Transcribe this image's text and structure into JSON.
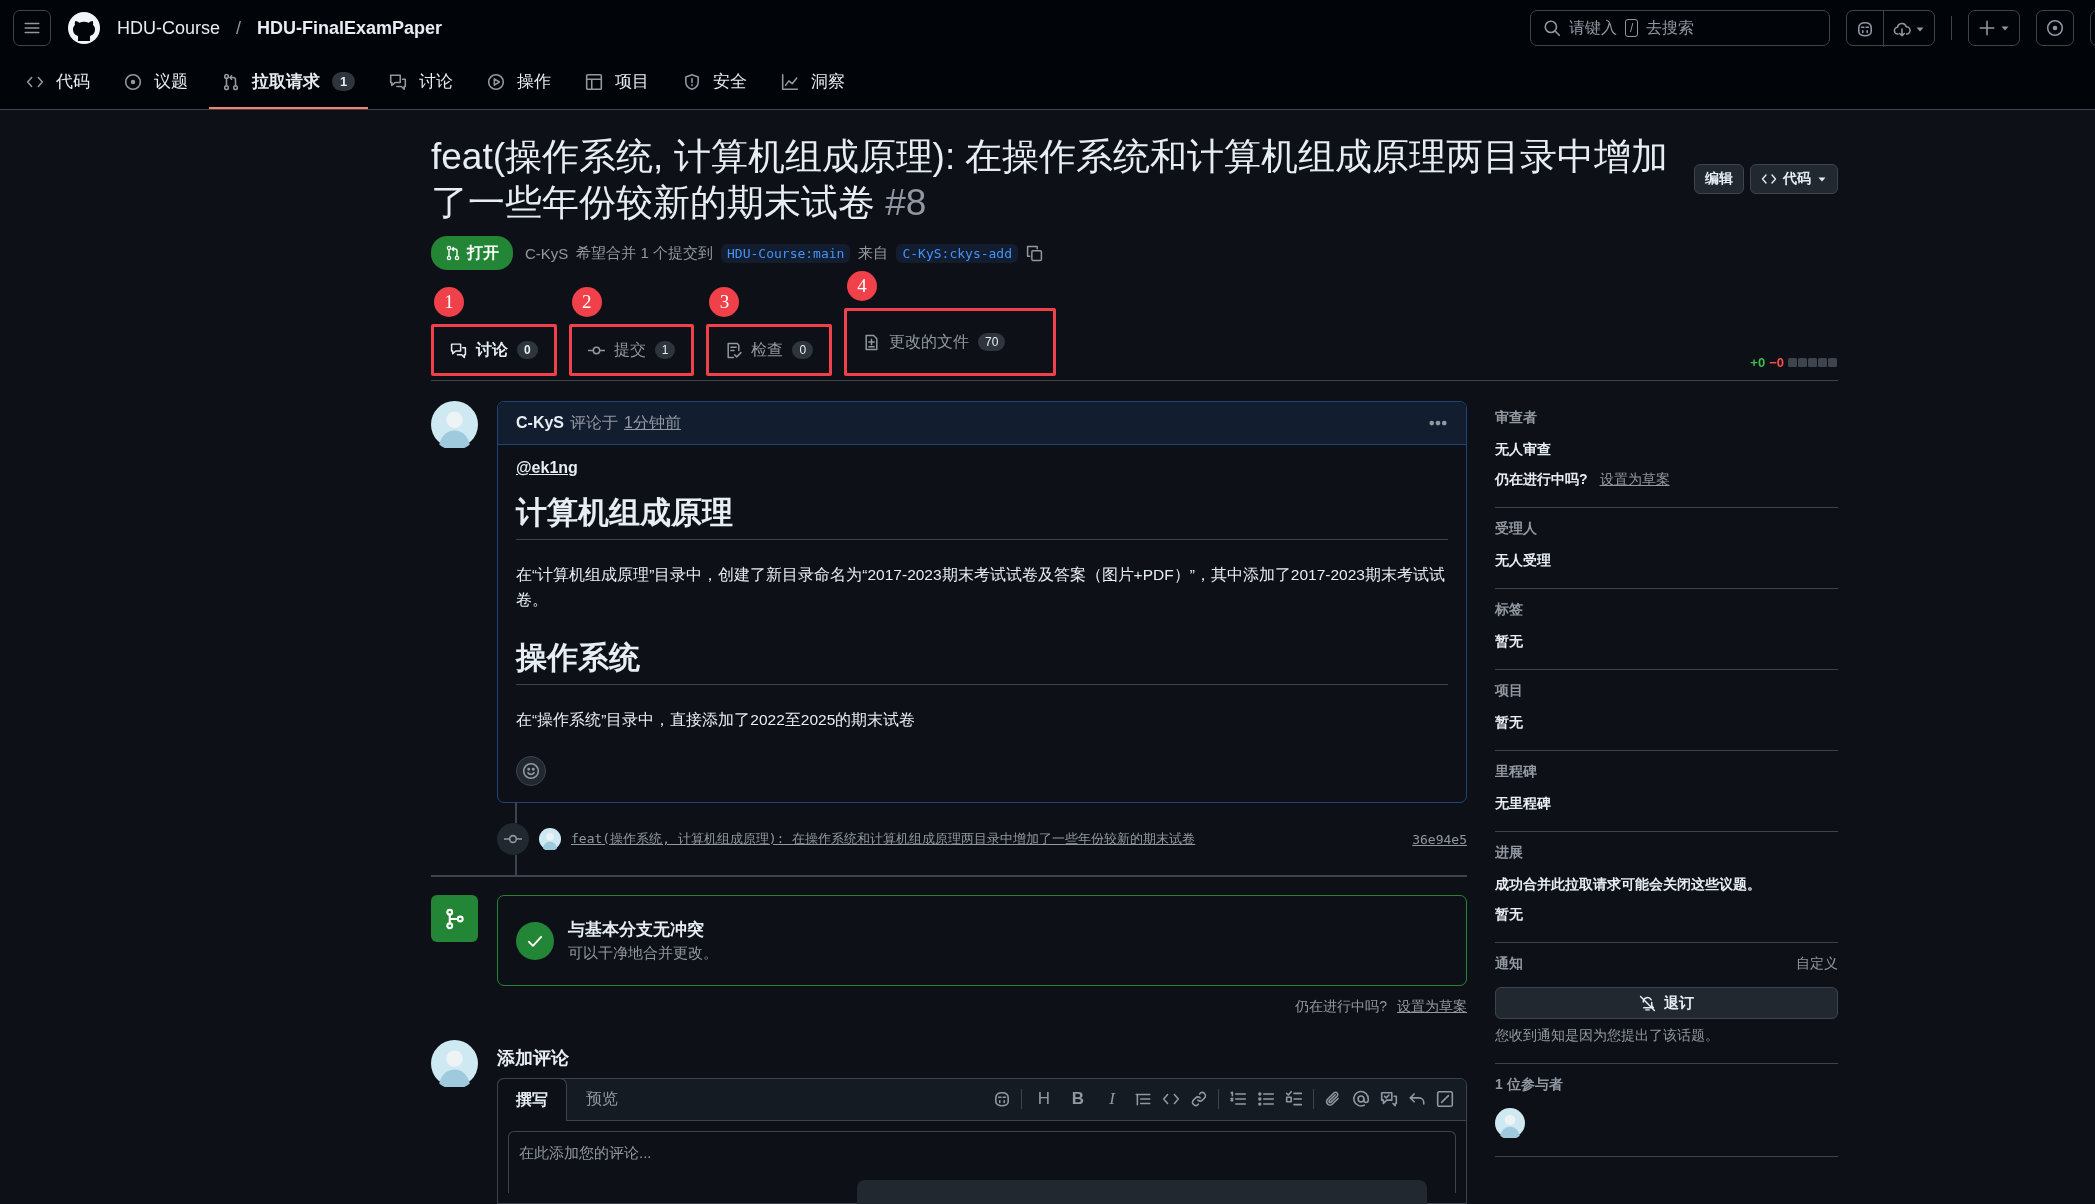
{
  "header": {
    "breadcrumb": [
      "HDU-Course",
      "HDU-FinalExamPaper"
    ],
    "separator": "/",
    "search": {
      "placeholder": "请键入",
      "key": "/",
      "placeholder_after": "去搜索"
    }
  },
  "repo_nav": [
    {
      "label": "代码",
      "selected": false
    },
    {
      "label": "议题",
      "selected": false
    },
    {
      "label": "拉取请求",
      "count": "1",
      "selected": true
    },
    {
      "label": "讨论",
      "selected": false
    },
    {
      "label": "操作",
      "selected": false
    },
    {
      "label": "项目",
      "selected": false
    },
    {
      "label": "安全",
      "selected": false
    },
    {
      "label": "洞察",
      "selected": false
    }
  ],
  "pull_request": {
    "title": "feat(操作系统, 计算机组成原理): 在操作系统和计算机组成原理两目录中增加了一些年份较新的期末试卷",
    "number": "#8",
    "buttons": [
      {
        "label": "编辑",
        "kind": "plain"
      },
      {
        "label": "代码",
        "kind": "menu"
      }
    ],
    "state": {
      "label": "打开",
      "kind": "open"
    },
    "author": "C-KyS",
    "summary": "希望合并 1 个提交到",
    "base_branch": "HDU-Course:main",
    "from_label": "来自",
    "head_branch": "C-KyS:ckys-add"
  },
  "tabs": [
    {
      "label": "讨论",
      "count": "0",
      "marker": "1",
      "selected": true
    },
    {
      "label": "提交",
      "count": "1",
      "marker": "2",
      "selected": false
    },
    {
      "label": "检查",
      "count": "0",
      "marker": "3",
      "selected": false
    },
    {
      "label": "更改的文件",
      "count": "70",
      "marker": "4",
      "selected": false
    }
  ],
  "diffstat": {
    "additions": "+0",
    "deletions": "−0"
  },
  "comment": {
    "author": "C-KyS",
    "action": "评论于",
    "time": "1分钟前",
    "mention": "@ek1ng",
    "sections": [
      {
        "heading": "计算机组成原理",
        "text": "在“计算机组成原理”目录中，创建了新目录命名为“2017-2023期末考试试卷及答案（图片+PDF）”，其中添加了2017-2023期末考试试卷。"
      },
      {
        "heading": "操作系统",
        "text": "在“操作系统”目录中，直接添加了2022至2025的期末试卷"
      }
    ]
  },
  "commit": {
    "message": "feat(操作系统, 计算机组成原理): 在操作系统和计算机组成原理两目录中增加了一些年份较新的期末试卷",
    "sha": "36e94e5"
  },
  "merge": {
    "title": "与基本分支无冲突",
    "subtitle": "可以干净地合并更改。",
    "has_conflicts": false
  },
  "draft": {
    "question": "仍在进行中吗?",
    "link": "设置为草案"
  },
  "editor": {
    "title": "添加评论",
    "tabs": [
      {
        "label": "撰写",
        "selected": true
      },
      {
        "label": "预览",
        "selected": false
      }
    ],
    "glyphs": [
      "H",
      "B",
      "I"
    ],
    "placeholder": "在此添加您的评论..."
  },
  "sidebar": [
    {
      "heading": "审查者",
      "lines": [
        "无人审查"
      ],
      "question": "仍在进行中吗?",
      "link": "设置为草案"
    },
    {
      "heading": "受理人",
      "lines": [
        "无人受理"
      ]
    },
    {
      "heading": "标签",
      "lines": [
        "暂无"
      ]
    },
    {
      "heading": "项目",
      "lines": [
        "暂无"
      ]
    },
    {
      "heading": "里程碑",
      "lines": [
        "无里程碑"
      ]
    },
    {
      "heading": "进展",
      "lines": [
        "成功合并此拉取请求可能会关闭这些议题。",
        "暂无"
      ]
    }
  ],
  "notifications": {
    "heading": "通知",
    "action": "自定义",
    "button": "退订",
    "note": "您收到通知是因为您提出了该话题。"
  },
  "participants": {
    "heading": "1 位参与者"
  }
}
